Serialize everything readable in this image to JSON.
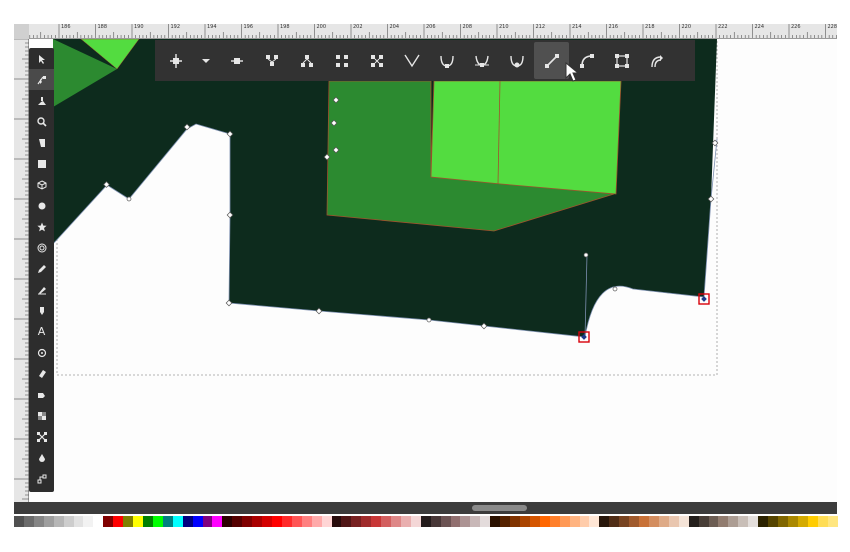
{
  "ruler": {
    "labels": [
      "186",
      "188",
      "190",
      "192",
      "194",
      "196",
      "198",
      "200",
      "202",
      "204",
      "206",
      "208",
      "210",
      "212",
      "214",
      "216",
      "218",
      "220",
      "222",
      "224",
      "226",
      "228"
    ]
  },
  "toolbox": {
    "tools": [
      {
        "name": "selector-tool",
        "icon": "arrow-icon"
      },
      {
        "name": "node-tool",
        "icon": "node-icon",
        "active": true
      },
      {
        "name": "tweak-tool",
        "icon": "tweak-icon"
      },
      {
        "name": "zoom-tool",
        "icon": "magnifier-icon"
      },
      {
        "name": "measure-tool",
        "icon": "measure-icon"
      },
      {
        "name": "rectangle-tool",
        "icon": "rectangle-icon"
      },
      {
        "name": "box3d-tool",
        "icon": "box3d-icon"
      },
      {
        "name": "ellipse-tool",
        "icon": "circle-icon"
      },
      {
        "name": "star-tool",
        "icon": "star-icon"
      },
      {
        "name": "spiral-tool",
        "icon": "spiral-icon"
      },
      {
        "name": "pencil-tool",
        "icon": "pencil-icon"
      },
      {
        "name": "pen-tool",
        "icon": "pen-icon"
      },
      {
        "name": "calligraphy-tool",
        "icon": "calligraphy-icon"
      },
      {
        "name": "text-tool",
        "icon": "text-icon"
      },
      {
        "name": "spray-tool",
        "icon": "spray-icon"
      },
      {
        "name": "eraser-tool",
        "icon": "eraser-icon"
      },
      {
        "name": "paint-bucket-tool",
        "icon": "bucket-icon"
      },
      {
        "name": "gradient-tool",
        "icon": "gradient-icon"
      },
      {
        "name": "mesh-tool",
        "icon": "mesh-icon"
      },
      {
        "name": "dropper-tool",
        "icon": "dropper-icon"
      },
      {
        "name": "connector-tool",
        "icon": "connector-icon"
      }
    ],
    "text_tool_glyph": "A"
  },
  "node_toolbar": {
    "buttons": [
      {
        "name": "insert-node-button",
        "icon": "insert-node-icon"
      },
      {
        "name": "insert-node-dropdown",
        "icon": "chevron-down-icon"
      },
      {
        "name": "delete-node-button",
        "icon": "delete-node-icon"
      },
      {
        "name": "join-nodes-button",
        "icon": "join-nodes-icon"
      },
      {
        "name": "break-path-button",
        "icon": "break-path-icon"
      },
      {
        "name": "join-segment-button",
        "icon": "join-segment-icon"
      },
      {
        "name": "delete-segment-button",
        "icon": "delete-segment-icon"
      },
      {
        "name": "cusp-node-button",
        "icon": "cusp-node-icon"
      },
      {
        "name": "smooth-node-button",
        "icon": "smooth-node-icon"
      },
      {
        "name": "symmetric-node-button",
        "icon": "symmetric-node-icon"
      },
      {
        "name": "auto-smooth-node-button",
        "icon": "auto-smooth-node-icon"
      },
      {
        "name": "segment-to-line-button",
        "icon": "segment-line-icon",
        "active": true
      },
      {
        "name": "segment-to-curve-button",
        "icon": "segment-curve-icon"
      },
      {
        "name": "object-to-path-button",
        "icon": "object-to-path-icon"
      },
      {
        "name": "stroke-to-path-button",
        "icon": "stroke-to-path-icon"
      }
    ]
  },
  "colors": {
    "dark_green": "#0d2b1d",
    "mid_green": "#2c8a30",
    "light_green": "#53dc40",
    "toolbar_bg": "#323232",
    "selected_node": "#d8000a"
  },
  "palette": [
    "#505050",
    "#6b6b6b",
    "#858585",
    "#9e9e9e",
    "#b6b6b6",
    "#cdcdcd",
    "#e2e2e2",
    "#f2f2f2",
    "#ffffff",
    "#800000",
    "#ff0000",
    "#808000",
    "#ffff00",
    "#008000",
    "#00ff00",
    "#008080",
    "#00ffff",
    "#000080",
    "#0000ff",
    "#800080",
    "#ff00ff",
    "#2b0000",
    "#550000",
    "#800000",
    "#aa0000",
    "#d40000",
    "#ff0000",
    "#ff2a2a",
    "#ff5555",
    "#ff8080",
    "#ffaaaa",
    "#ffd5d5",
    "#280b0b",
    "#501616",
    "#782121",
    "#a02c2c",
    "#c83737",
    "#d35f5f",
    "#de8787",
    "#e9afaf",
    "#f4d7d7",
    "#241c1c",
    "#483737",
    "#6c5353",
    "#916f6f",
    "#ac9393",
    "#c8b7b7",
    "#e3dbdb",
    "#2b1100",
    "#552200",
    "#803300",
    "#aa4400",
    "#d45500",
    "#ff6600",
    "#ff7f2a",
    "#ff9955",
    "#ffb380",
    "#ffccaa",
    "#ffe6d5",
    "#28170b",
    "#502d16",
    "#784421",
    "#a05a2c",
    "#c87137",
    "#d38d5f",
    "#deaa87",
    "#e9c6af",
    "#f4e3d7",
    "#241f1c",
    "#483e37",
    "#6c5d53",
    "#917c6f",
    "#ac9d93",
    "#c8beb7",
    "#e3dedb",
    "#2b2200",
    "#554400",
    "#806600",
    "#aa8800",
    "#d4aa00",
    "#ffcc00",
    "#ffdd55",
    "#ffe680"
  ]
}
